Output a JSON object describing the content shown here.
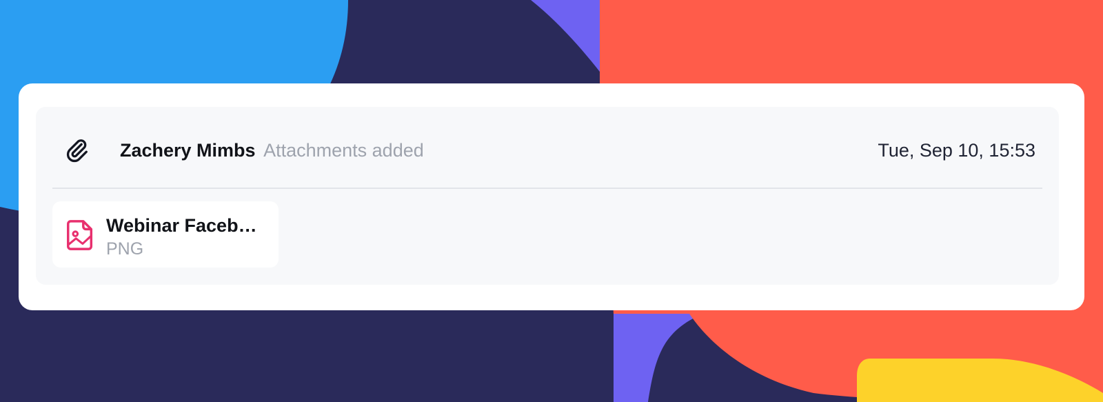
{
  "colors": {
    "page_bg": "#2a2a5a",
    "blue": "#2b9ef2",
    "purple": "#6e62f2",
    "coral": "#ff5c4a",
    "yellow": "#fdd22a",
    "file_accent": "#e8306e"
  },
  "activity": {
    "icon": "paperclip-icon",
    "actor": "Zachery Mimbs",
    "action": "Attachments added",
    "timestamp": "Tue, Sep 10, 15:53"
  },
  "attachments": [
    {
      "name": "Webinar Facebo…",
      "type": "PNG",
      "icon": "image-file-icon"
    }
  ]
}
